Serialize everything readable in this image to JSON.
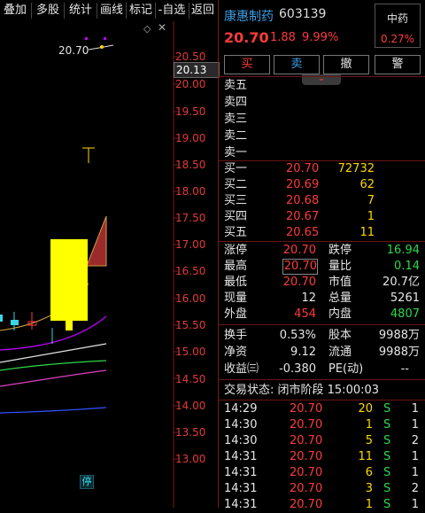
{
  "toolbar": {
    "items": [
      "叠加",
      "多股",
      "统计",
      "画线",
      "标记",
      "-自选",
      "返回"
    ]
  },
  "chart": {
    "price_labels": [
      "20.50",
      "20.00",
      "19.50",
      "19.00",
      "18.50",
      "18.00",
      "17.50",
      "17.00",
      "16.50",
      "16.00",
      "15.50",
      "15.00",
      "14.50",
      "14.00",
      "13.50",
      "13.00"
    ],
    "current_price": "20.13",
    "high_marker": "20.70",
    "halt_badge": "停",
    "diamond_icon": "diamond-icon"
  },
  "stock": {
    "name": "康惠制药",
    "code": "603139",
    "price": "20.70",
    "change": "1.88",
    "change_pct": "9.99%",
    "sector": "中药",
    "sector_pct": "0.27%"
  },
  "actions": {
    "buy": "买",
    "sell": "卖",
    "cancel": "撤",
    "alert": "警"
  },
  "sell_levels": [
    {
      "label": "卖五"
    },
    {
      "label": "卖四"
    },
    {
      "label": "卖三"
    },
    {
      "label": "卖二"
    },
    {
      "label": "卖一"
    }
  ],
  "buy_levels": [
    {
      "label": "买一",
      "price": "20.70",
      "vol": "72732"
    },
    {
      "label": "买二",
      "price": "20.69",
      "vol": "62"
    },
    {
      "label": "买三",
      "price": "20.68",
      "vol": "7"
    },
    {
      "label": "买四",
      "price": "20.67",
      "vol": "1"
    },
    {
      "label": "买五",
      "price": "20.65",
      "vol": "11"
    }
  ],
  "stats": {
    "zt_label": "涨停",
    "zt": "20.70",
    "dt_label": "跌停",
    "dt": "16.94",
    "high_label": "最高",
    "high": "20.70",
    "lb_label": "量比",
    "lb": "0.14",
    "low_label": "最低",
    "low": "20.70",
    "mv_label": "市值",
    "mv": "20.7亿",
    "xl_label": "现量",
    "xl": "12",
    "zl_label": "总量",
    "zl": "5261",
    "wp_label": "外盘",
    "wp": "454",
    "np_label": "内盘",
    "np": "4807",
    "hs_label": "换手",
    "hs": "0.53%",
    "gb_label": "股本",
    "gb": "9988万",
    "jz_label": "净资",
    "jz": "9.12",
    "lt_label": "流通",
    "lt": "9988万",
    "sy_label": "收益㈢",
    "sy": "-0.380",
    "pe_label": "PE(动)",
    "pe": "--"
  },
  "trade_status": "交易状态: 闭市阶段 15:00:03",
  "ticks": [
    {
      "time": "14:29",
      "price": "20.70",
      "vol": "20",
      "side": "S",
      "n": "1"
    },
    {
      "time": "14:30",
      "price": "20.70",
      "vol": "1",
      "side": "S",
      "n": "1"
    },
    {
      "time": "14:30",
      "price": "20.70",
      "vol": "5",
      "side": "S",
      "n": "2"
    },
    {
      "time": "14:31",
      "price": "20.70",
      "vol": "11",
      "side": "S",
      "n": "1"
    },
    {
      "time": "14:31",
      "price": "20.70",
      "vol": "6",
      "side": "S",
      "n": "1"
    },
    {
      "time": "14:31",
      "price": "20.70",
      "vol": "3",
      "side": "S",
      "n": "2"
    },
    {
      "time": "14:31",
      "price": "20.70",
      "vol": "1",
      "side": "S",
      "n": "1"
    }
  ],
  "colors": {
    "up": "#ff3b3b",
    "down": "#2dd84a",
    "vol": "#ffd700",
    "name": "#3b9fe6"
  }
}
